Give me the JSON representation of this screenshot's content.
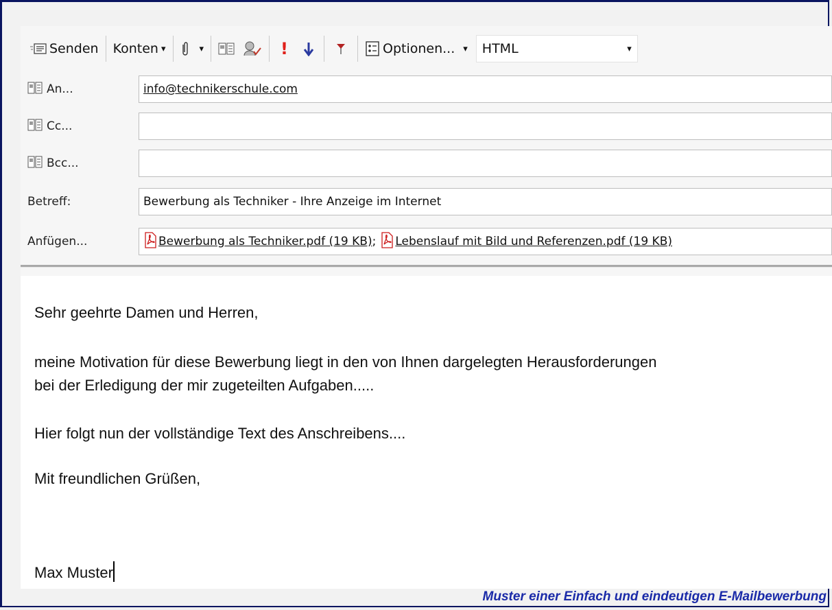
{
  "toolbar": {
    "send_label": "Senden",
    "accounts_label": "Konten",
    "options_label": "Optionen...",
    "format_value": "HTML"
  },
  "header": {
    "to_label": "An...",
    "to_value": "info@technikerschule.com",
    "cc_label": "Cc...",
    "cc_value": "",
    "bcc_label": "Bcc...",
    "bcc_value": "",
    "subject_label": "Betreff:",
    "subject_value": "Bewerbung als Techniker - Ihre Anzeige im Internet",
    "attach_label": "Anfügen...",
    "attachments": [
      {
        "name": "Bewerbung als Techniker.pdf (19 KB)",
        "separator": ";"
      },
      {
        "name": "Lebenslauf mit Bild und Referenzen.pdf (19 KB)",
        "separator": ""
      }
    ]
  },
  "body": {
    "greeting": "Sehr geehrte Damen und Herren,",
    "para1_line1": "meine Motivation für diese Bewerbung liegt in den von Ihnen dargelegten Herausforderungen",
    "para1_line2": "bei der Erledigung der mir zugeteilten Aufgaben.....",
    "para2": "Hier folgt nun der vollständige Text des Anschreibens....",
    "closing": "Mit freundlichen Grüßen,",
    "signature": "Max Muster"
  },
  "caption": "Muster einer Einfach und eindeutigen E-Mailbewerbung",
  "colors": {
    "frame": "#0a1560",
    "caption": "#1a2aa8",
    "importance_high": "#e0201a",
    "importance_low": "#2a3aa0",
    "pdf_icon": "#cc1b1b"
  },
  "icons": [
    "send-icon",
    "paperclip-icon",
    "address-book-icon",
    "check-names-icon",
    "importance-high-icon",
    "importance-low-icon",
    "flag-icon",
    "options-icon",
    "pdf-icon"
  ]
}
